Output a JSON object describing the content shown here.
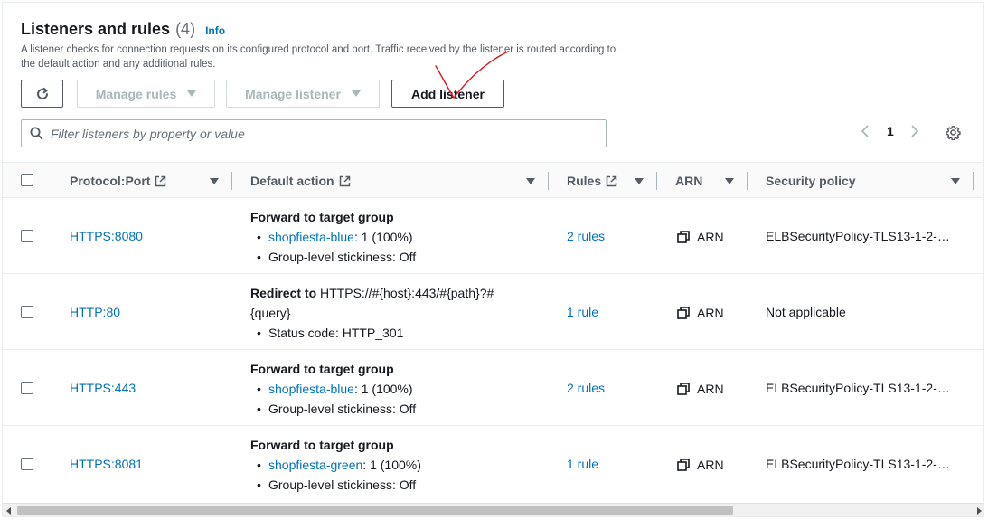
{
  "header": {
    "title": "Listeners and rules",
    "count": "(4)",
    "info_link": "Info",
    "description": "A listener checks for connection requests on its configured protocol and port. Traffic received by the listener is routed according to the default action and any additional rules."
  },
  "toolbar": {
    "refresh_icon": "refresh-icon",
    "manage_rules_label": "Manage rules",
    "manage_listener_label": "Manage listener",
    "add_listener_label": "Add listener"
  },
  "search": {
    "placeholder": "Filter listeners by property or value",
    "value": ""
  },
  "pagination": {
    "current_page": "1"
  },
  "table": {
    "columns": [
      {
        "label": "Protocol:Port"
      },
      {
        "label": "Default action"
      },
      {
        "label": "Rules"
      },
      {
        "label": "ARN"
      },
      {
        "label": "Security policy"
      }
    ],
    "rows": [
      {
        "protocol_port": "HTTPS:8080",
        "action_title": "Forward to target group",
        "action_prefix": "",
        "action_target": "shopfiesta-blue",
        "action_target_suffix": ": 1 (100%)",
        "action_detail": "Group-level stickiness: Off",
        "rules": "2 rules",
        "arn": "ARN",
        "security_policy": "ELBSecurityPolicy-TLS13-1-2-…"
      },
      {
        "protocol_port": "HTTP:80",
        "action_title": "Redirect to",
        "action_redirect_line1": "HTTPS://#{host}:443/#{path}?#",
        "action_redirect_line2": "{query}",
        "action_detail": "Status code: HTTP_301",
        "rules": "1 rule",
        "arn": "ARN",
        "security_policy": "Not applicable"
      },
      {
        "protocol_port": "HTTPS:443",
        "action_title": "Forward to target group",
        "action_target": "shopfiesta-blue",
        "action_target_suffix": ": 1 (100%)",
        "action_detail": "Group-level stickiness: Off",
        "rules": "2 rules",
        "arn": "ARN",
        "security_policy": "ELBSecurityPolicy-TLS13-1-2-…"
      },
      {
        "protocol_port": "HTTPS:8081",
        "action_title": "Forward to target group",
        "action_target": "shopfiesta-green",
        "action_target_suffix": ": 1 (100%)",
        "action_detail": "Group-level stickiness: Off",
        "rules": "1 rule",
        "arn": "ARN",
        "security_policy": "ELBSecurityPolicy-TLS13-1-2-…"
      }
    ]
  },
  "colors": {
    "link": "#0073bb",
    "text": "#16191f",
    "muted": "#545b64",
    "annotation": "#e0161b"
  }
}
